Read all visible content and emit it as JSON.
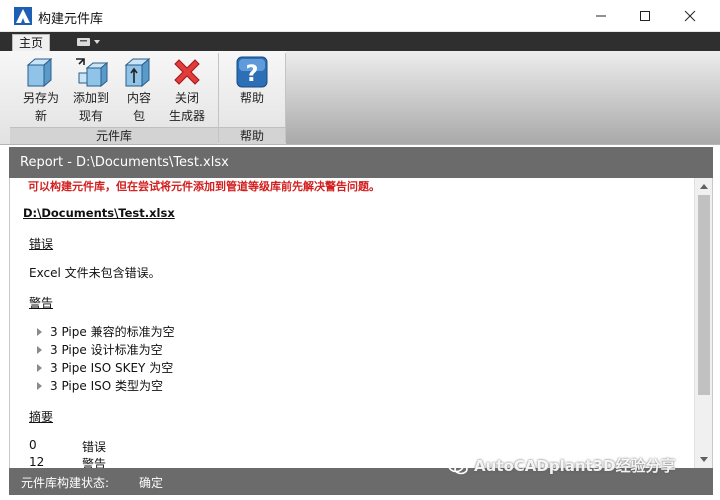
{
  "window": {
    "title": "构建元件库"
  },
  "ribbon": {
    "tab_home": "主页",
    "buttons": [
      {
        "label": "另存为新",
        "line1": "另存为",
        "line2": "新",
        "icon": "cube-save-icon"
      },
      {
        "label": "添加到现有",
        "line1": "添加到",
        "line2": "现有",
        "icon": "cube-add-icon"
      },
      {
        "label": "内容包",
        "line1": "内容",
        "line2": "包",
        "icon": "cube-content-icon"
      },
      {
        "label": "关闭生成器",
        "line1": "关闭",
        "line2": "生成器",
        "icon": "close-red-x-icon"
      },
      {
        "label": "帮助",
        "line1": "帮助",
        "line2": "",
        "icon": "help-question-icon"
      }
    ],
    "panels": {
      "library": "元件库",
      "help": "帮助"
    }
  },
  "report": {
    "header": "Report - D:\\Documents\\Test.xlsx",
    "warning_message": "可以构建元件库，但在尝试将元件添加到管道等级库前先解决警告问题。",
    "file_path": "D:\\Documents\\Test.xlsx",
    "errors_title": "错误",
    "errors_text": "Excel 文件未包含错误。",
    "warnings_title": "警告",
    "warnings": [
      "3 Pipe 兼容的标准为空",
      "3 Pipe 设计标准为空",
      "3 Pipe ISO SKEY 为空",
      "3 Pipe ISO 类型为空"
    ],
    "summary_title": "摘要",
    "summary": [
      {
        "count": "0",
        "label": "错误"
      },
      {
        "count": "12",
        "label": "警告"
      }
    ]
  },
  "status": {
    "label": "元件库构建状态:",
    "value": "确定"
  },
  "watermark": "AutoCADplant3D经验分享"
}
